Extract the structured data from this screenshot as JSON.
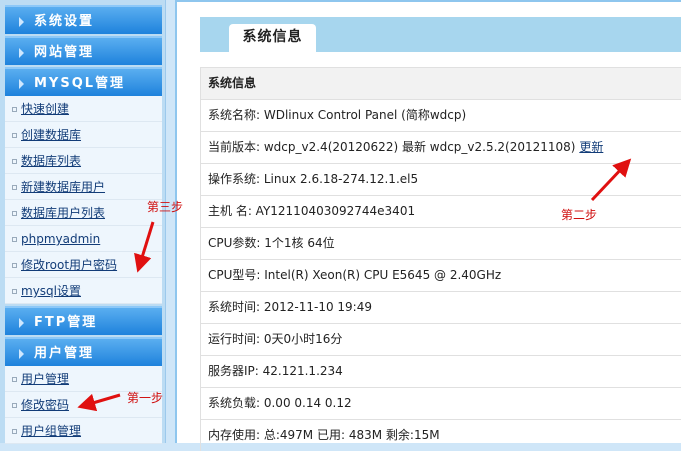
{
  "sidebar": {
    "sections": [
      "系统设置",
      "网站管理",
      "MYSQL管理",
      "FTP管理",
      "用户管理"
    ],
    "mysql_links": [
      "快速创建",
      "创建数据库",
      "数据库列表",
      "新建数据库用户",
      "数据库用户列表",
      "phpmyadmin",
      "修改root用户密码",
      "mysql设置"
    ],
    "user_links": [
      "用户管理",
      "修改密码",
      "用户组管理"
    ]
  },
  "main": {
    "tab": "系统信息",
    "header": "系统信息",
    "rows": [
      "系统名称: WDlinux Control Panel (简称wdcp)",
      "当前版本: wdcp_v2.4(20120622) 最新  wdcp_v2.5.2(20121108)",
      "操作系统: Linux 2.6.18-274.12.1.el5",
      "主机 名: AY12110403092744e3401",
      "CPU参数: 1个1核 64位",
      "CPU型号:  Intel(R) Xeon(R) CPU E5645 @ 2.40GHz",
      "系统时间: 2012-11-10 19:49",
      "运行时间: 0天0小时16分",
      "服务器IP: 42.121.1.234",
      "系统负载: 0.00   0.14   0.12",
      "内存使用: 总:497M   已用: 483M   剩余:15M"
    ],
    "update_link": "更新"
  },
  "annotations": {
    "step1": "第一步",
    "step2": "第二步",
    "step3": "第三步",
    "color": "#d01010"
  }
}
